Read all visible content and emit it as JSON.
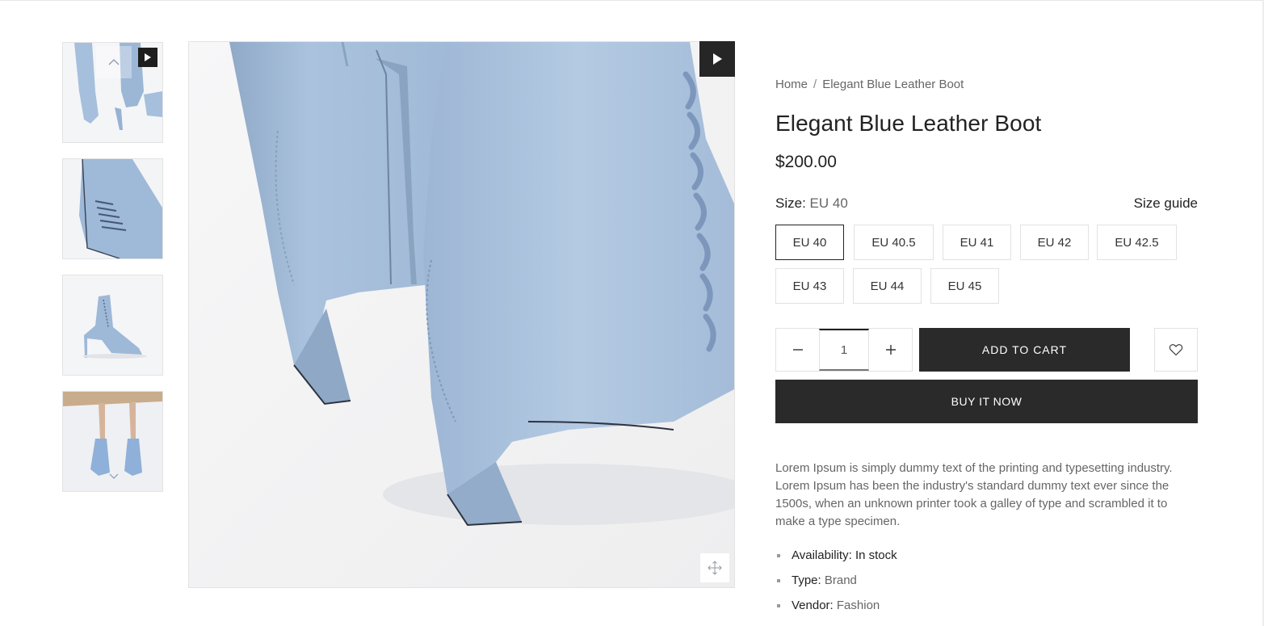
{
  "breadcrumb": {
    "home": "Home",
    "separator": "/",
    "current": "Elegant Blue Leather Boot"
  },
  "product": {
    "title": "Elegant Blue Leather Boot",
    "price": "$200.00",
    "size_label": "Size:",
    "size_selected": "EU 40",
    "size_guide": "Size guide",
    "sizes": [
      "EU 40",
      "EU 40.5",
      "EU 41",
      "EU 42",
      "EU 42.5",
      "EU 43",
      "EU 44",
      "EU 45"
    ],
    "quantity": "1",
    "add_to_cart": "ADD TO CART",
    "buy_now": "BUY IT NOW",
    "description": "Lorem Ipsum is simply dummy text of the printing and typesetting industry. Lorem Ipsum has been the industry's standard dummy text ever since the 1500s, when an unknown printer took a galley of type and scrambled it to make a type specimen.",
    "meta": [
      {
        "label": "Availability:",
        "value": "In stock"
      },
      {
        "label": "Type:",
        "value": "Brand"
      },
      {
        "label": "Vendor:",
        "value": "Fashion"
      }
    ]
  },
  "icons": {
    "play": "play-icon",
    "up": "chevron-up-icon",
    "down": "chevron-down-icon",
    "zoom": "move-icon",
    "minus": "minus-icon",
    "plus": "plus-icon",
    "heart": "heart-icon"
  },
  "colors": {
    "boot": "#a9c1dc",
    "button_dark": "#2a2a2a",
    "border": "#e2e2e2"
  }
}
